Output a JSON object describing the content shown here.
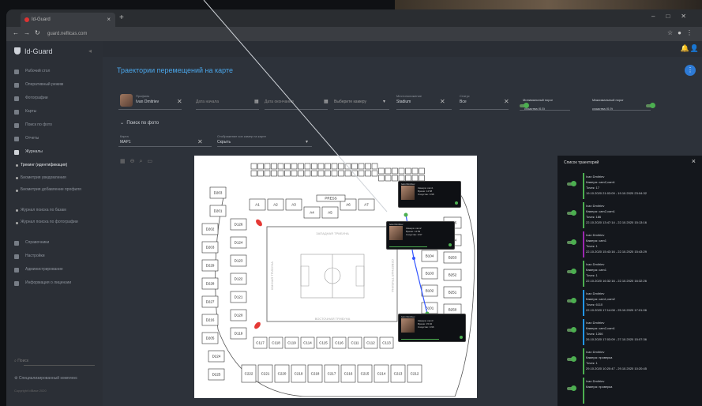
{
  "browser": {
    "tab_title": "Id-Guard",
    "url": "guard.neflicas.com",
    "tab_close": "×",
    "new_tab": "+"
  },
  "sidebar": {
    "logo": "Id-Guard",
    "items": [
      {
        "label": "Рабочий стол",
        "active": false
      },
      {
        "label": "Оперативный режим",
        "active": false
      },
      {
        "label": "Фотографии",
        "active": false
      },
      {
        "label": "Карты",
        "active": false
      },
      {
        "label": "Поиск по фото",
        "active": false
      },
      {
        "label": "Отчеты",
        "active": false
      },
      {
        "label": "Журналы",
        "active": false
      }
    ],
    "subitems": [
      {
        "label": "Трекинг (идентификация)",
        "active": true
      },
      {
        "label": "Биометрия уведомления",
        "active": false
      },
      {
        "label": "Биометрия добавление профиля",
        "active": false
      },
      {
        "label": "Журнал поиска по базам",
        "active": false
      },
      {
        "label": "Журнал поиска по фотографии",
        "active": false
      }
    ],
    "items2": [
      {
        "label": "Справочники"
      },
      {
        "label": "Настройки"
      },
      {
        "label": "Администрирование"
      },
      {
        "label": "Информация о лицензии"
      }
    ],
    "search_placeholder": "Поиск",
    "bottom_label": "Специализированный комплекс",
    "copyright": "Copyright IdBase 2020"
  },
  "page": {
    "title": "Траектории перемещений на карте",
    "filters": {
      "person_label": "Профиль",
      "person_value": "Ivan Dmitriev",
      "date_from_placeholder": "Дата начала",
      "date_to_placeholder": "Дата окончания",
      "camera_placeholder": "Выберите камеру",
      "location_label": "Местоположение",
      "location_value": "Stadium",
      "type_label": "Статус",
      "type_value": "Все",
      "toggle1_line1": "Минимальный порог",
      "toggle1_line2": "сходства (0.5)",
      "toggle2_line1": "Максимальный порог",
      "toggle2_line2": "сходства (0.9)"
    },
    "photo_search": "Поиск по фото",
    "map_label": "Карта",
    "map_value": "MAP1",
    "zones_label": "Отображение зон камер на карте",
    "zones_value": "Скрыть"
  },
  "map": {
    "stands": {
      "west": "ЗАПАДНАЯ ТРИБУНА",
      "east": "ВОСТОЧНАЯ ТРИБУНА",
      "south": "ЮЖНАЯ ТРИБУНА",
      "north": "СЕВЕРНАЯ ТРИБУНА"
    },
    "sectors_left": [
      "D203",
      "D201",
      "D202",
      "D203",
      "D229",
      "D228",
      "D227",
      "D216",
      "D205",
      "D224",
      "D225"
    ],
    "sectors_left2": [
      "D126",
      "D124",
      "D123",
      "D122",
      "D121",
      "D120",
      "D119"
    ],
    "sectors_top": [
      "A1",
      "A2",
      "A3",
      "A4",
      "A5",
      "A6",
      "A7"
    ],
    "press": "PRESS",
    "sectors_right": [
      "B205",
      "B254",
      "B253",
      "B252",
      "B251",
      "B250"
    ],
    "sectors_right2": [
      "B104",
      "B103",
      "B102",
      "B101"
    ],
    "sectors_bottom": [
      "C117",
      "C118",
      "C119",
      "C114",
      "C115",
      "C116",
      "C111",
      "C112",
      "C113"
    ],
    "sectors_bottom2": [
      "C222",
      "C221",
      "C220",
      "C219",
      "C218",
      "C217",
      "C216",
      "C215",
      "C214",
      "C213",
      "C212"
    ],
    "cams": [
      {
        "caption": "Ivan Dmitriev",
        "line1": "Камера: cam1",
        "line2": "Время: 14:58",
        "line3": "Сходство: 0.98"
      },
      {
        "caption": "Ivan Dmitriev",
        "line1": "Камера: cam2",
        "line2": "Время: 14:59",
        "line3": "Сходство: 0.97"
      },
      {
        "caption": "Ivan Dmitriev",
        "line1": "Камера: cam3",
        "line2": "Время: 15:02",
        "line3": "Сходство: 0.96"
      }
    ]
  },
  "panel": {
    "title": "Список траекторий",
    "close": "×",
    "items": [
      {
        "name": "Ivan Dmitriev",
        "camera": "Камера: cam2,cam1",
        "points": "Точек: 17",
        "range": "19.10.2020 21:03:09 - 19.10.2020 23:04:32",
        "color": "#4caf50"
      },
      {
        "name": "Ivan Dmitriev",
        "camera": "Камера: cam2,cam1",
        "points": "Точек: 186",
        "range": "22.10.2020 13:47:14 - 22.10.2020 15:13:16",
        "color": "#4caf50"
      },
      {
        "name": "Ivan Dmitriev",
        "camera": "Камера: cam1",
        "points": "Точек: 1",
        "range": "22.10.2020 15:43:16 - 22.10.2020 15:43:29",
        "color": "#9c27b0"
      },
      {
        "name": "Ivan Dmitriev",
        "camera": "Камера: cam1",
        "points": "Точек: 1",
        "range": "22.10.2020 16:32:16 - 22.10.2020 16:32:26",
        "color": "#4caf50"
      },
      {
        "name": "Ivan Dmitriev",
        "camera": "Камера: cam1,cam2",
        "points": "Точек: 6110",
        "range": "22.10.2020 17:14:08 - 25.10.2020 17:01:06",
        "color": "#2196f3"
      },
      {
        "name": "Ivan Dmitriev",
        "camera": "Камера: cam2,cam1",
        "points": "Точек: 1266",
        "range": "26.10.2020 17:03:09 - 27.10.2020 15:07:36",
        "color": "#2196f3"
      },
      {
        "name": "Ivan Dmitriev",
        "camera": "Камера: проверка",
        "points": "Точек: 1",
        "range": "29.10.2020 10:20:47 - 29.10.2020 10:20:45",
        "color": "#4caf50"
      },
      {
        "name": "Ivan Dmitriev",
        "camera": "Камера: проверка",
        "points": "",
        "range": "",
        "color": "#4caf50"
      }
    ]
  }
}
